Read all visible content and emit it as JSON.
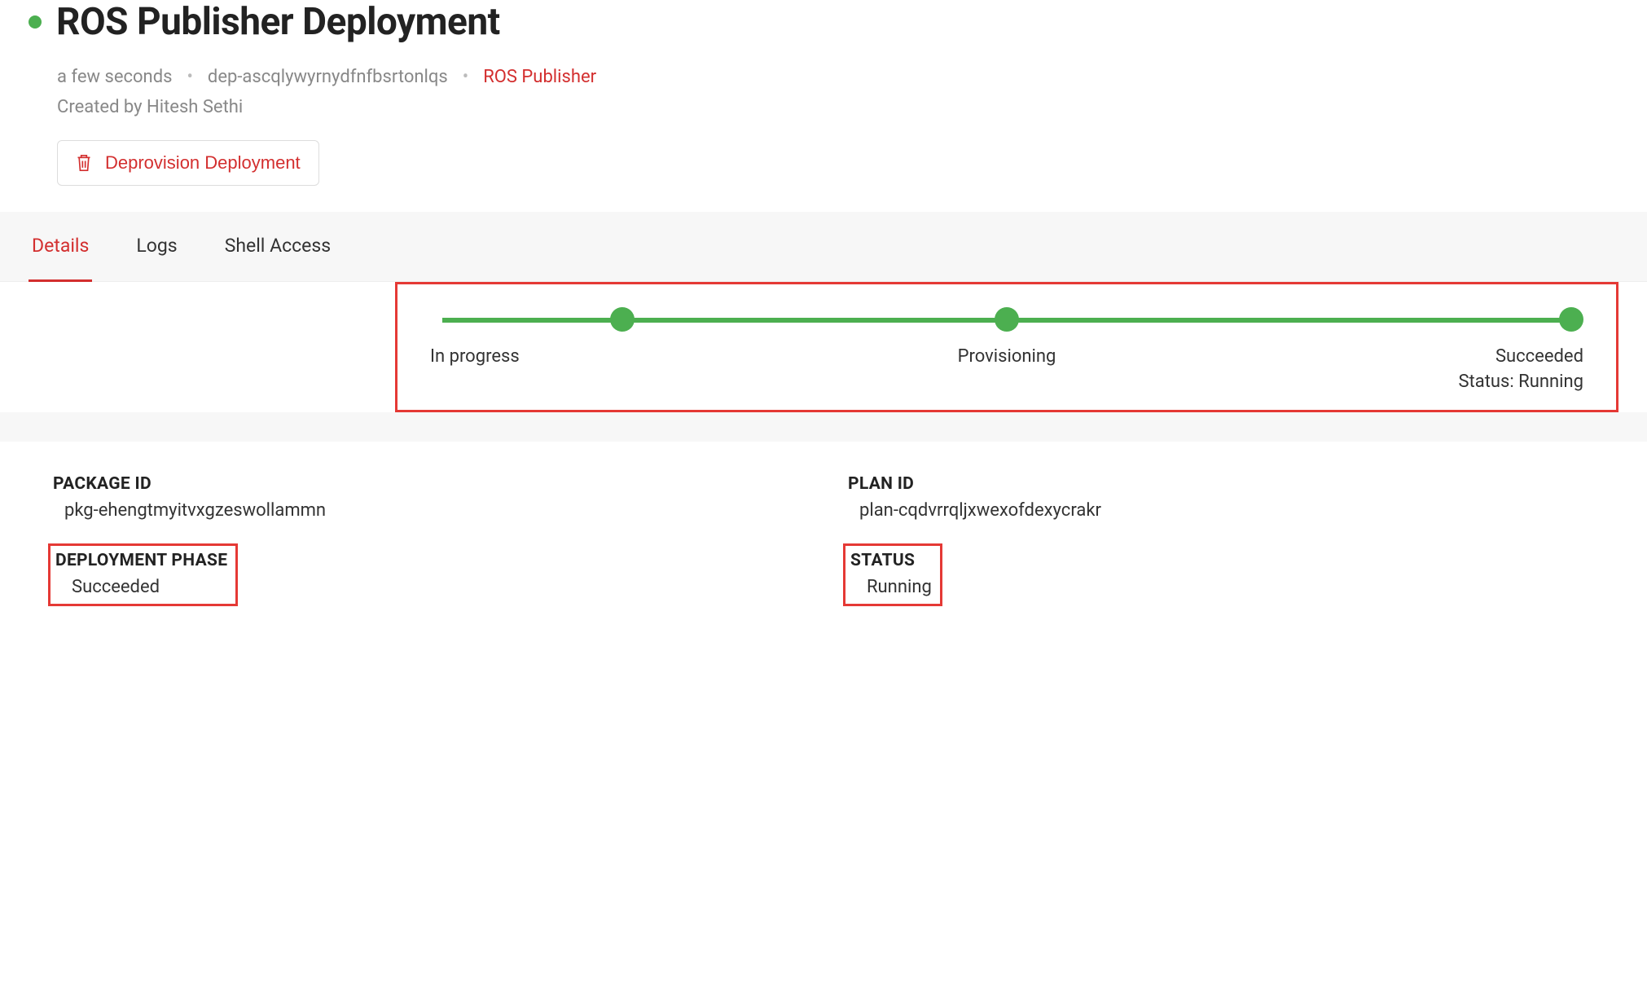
{
  "header": {
    "title": "ROS Publisher Deployment",
    "meta": {
      "age": "a few seconds",
      "dep_id": "dep-ascqlywyrnydfnfbsrtonlqs",
      "package_name": "ROS Publisher"
    },
    "created_by_label": "Created by Hitesh Sethi",
    "deprovision_label": "Deprovision Deployment"
  },
  "tabs": {
    "details": "Details",
    "logs": "Logs",
    "shell": "Shell Access"
  },
  "progress": {
    "steps": [
      "In progress",
      "Provisioning",
      "Succeeded"
    ],
    "status_line": "Status: Running"
  },
  "details": {
    "package_id_label": "PACKAGE ID",
    "package_id_value": "pkg-ehengtmyitvxgzeswollammn",
    "plan_id_label": "PLAN ID",
    "plan_id_value": "plan-cqdvrrqljxwexofdexycrakr",
    "phase_label": "DEPLOYMENT PHASE",
    "phase_value": "Succeeded",
    "status_label": "STATUS",
    "status_value": "Running"
  }
}
